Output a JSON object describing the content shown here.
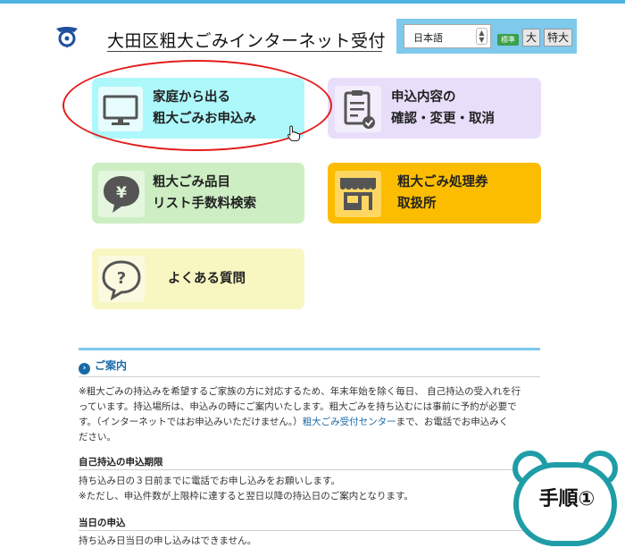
{
  "header": {
    "title": "大田区粗大ごみインターネット受付",
    "language": "日本語",
    "font_size": {
      "standard": "標準",
      "large": "大",
      "xlarge": "特大"
    }
  },
  "menu": [
    {
      "id": "home-request",
      "line1": "家庭から出る",
      "line2": "粗大ごみお申込み",
      "color": "#adf8fb",
      "icon": "monitor-icon",
      "highlighted": true
    },
    {
      "id": "confirm-change",
      "line1": "申込内容の",
      "line2": "確認・変更・取消",
      "color": "#e8defa",
      "icon": "clipboard-check-icon"
    },
    {
      "id": "item-search",
      "line1": "粗大ごみ品目",
      "line2": "リスト手数料検索",
      "color": "#cdeec3",
      "icon": "yen-bubble-icon"
    },
    {
      "id": "ticket-shops",
      "line1": "粗大ごみ処理券",
      "line2": "取扱所",
      "color": "#fcbd00",
      "icon": "shop-icon"
    },
    {
      "id": "faq",
      "line1": "よくある質問",
      "line2": "",
      "color": "#f8f6c1",
      "icon": "question-bubble-icon"
    }
  ],
  "guide": {
    "heading": "ご案内",
    "paragraph_lines": [
      "※粗大ごみの持込みを希望するご家族の方に対応するため、年末年始を除く毎日、 自己持込の受入れを行",
      "っています。持込場所は、申込みの時にご案内いたします。粗大ごみを持ち込むには事前に予約が必要で",
      "す。（インターネットではお申込みいただけません。）"
    ],
    "paragraph_link": "粗大ごみ受付センター",
    "paragraph_after_link": "まで、お電話でお申込みく",
    "paragraph_last": "ださい。",
    "self_delivery": {
      "heading": "自己持込の申込期限",
      "line1": "持ち込み日の３日前までに電話でお申し込みをお願いします。",
      "line2": "※ただし、申込件数が上限枠に達すると翌日以降の持込日のご案内となります。"
    },
    "same_day": {
      "heading": "当日の申込",
      "line1": "持ち込み日当日の申し込みはできません。"
    }
  },
  "step_badge": "手順①"
}
